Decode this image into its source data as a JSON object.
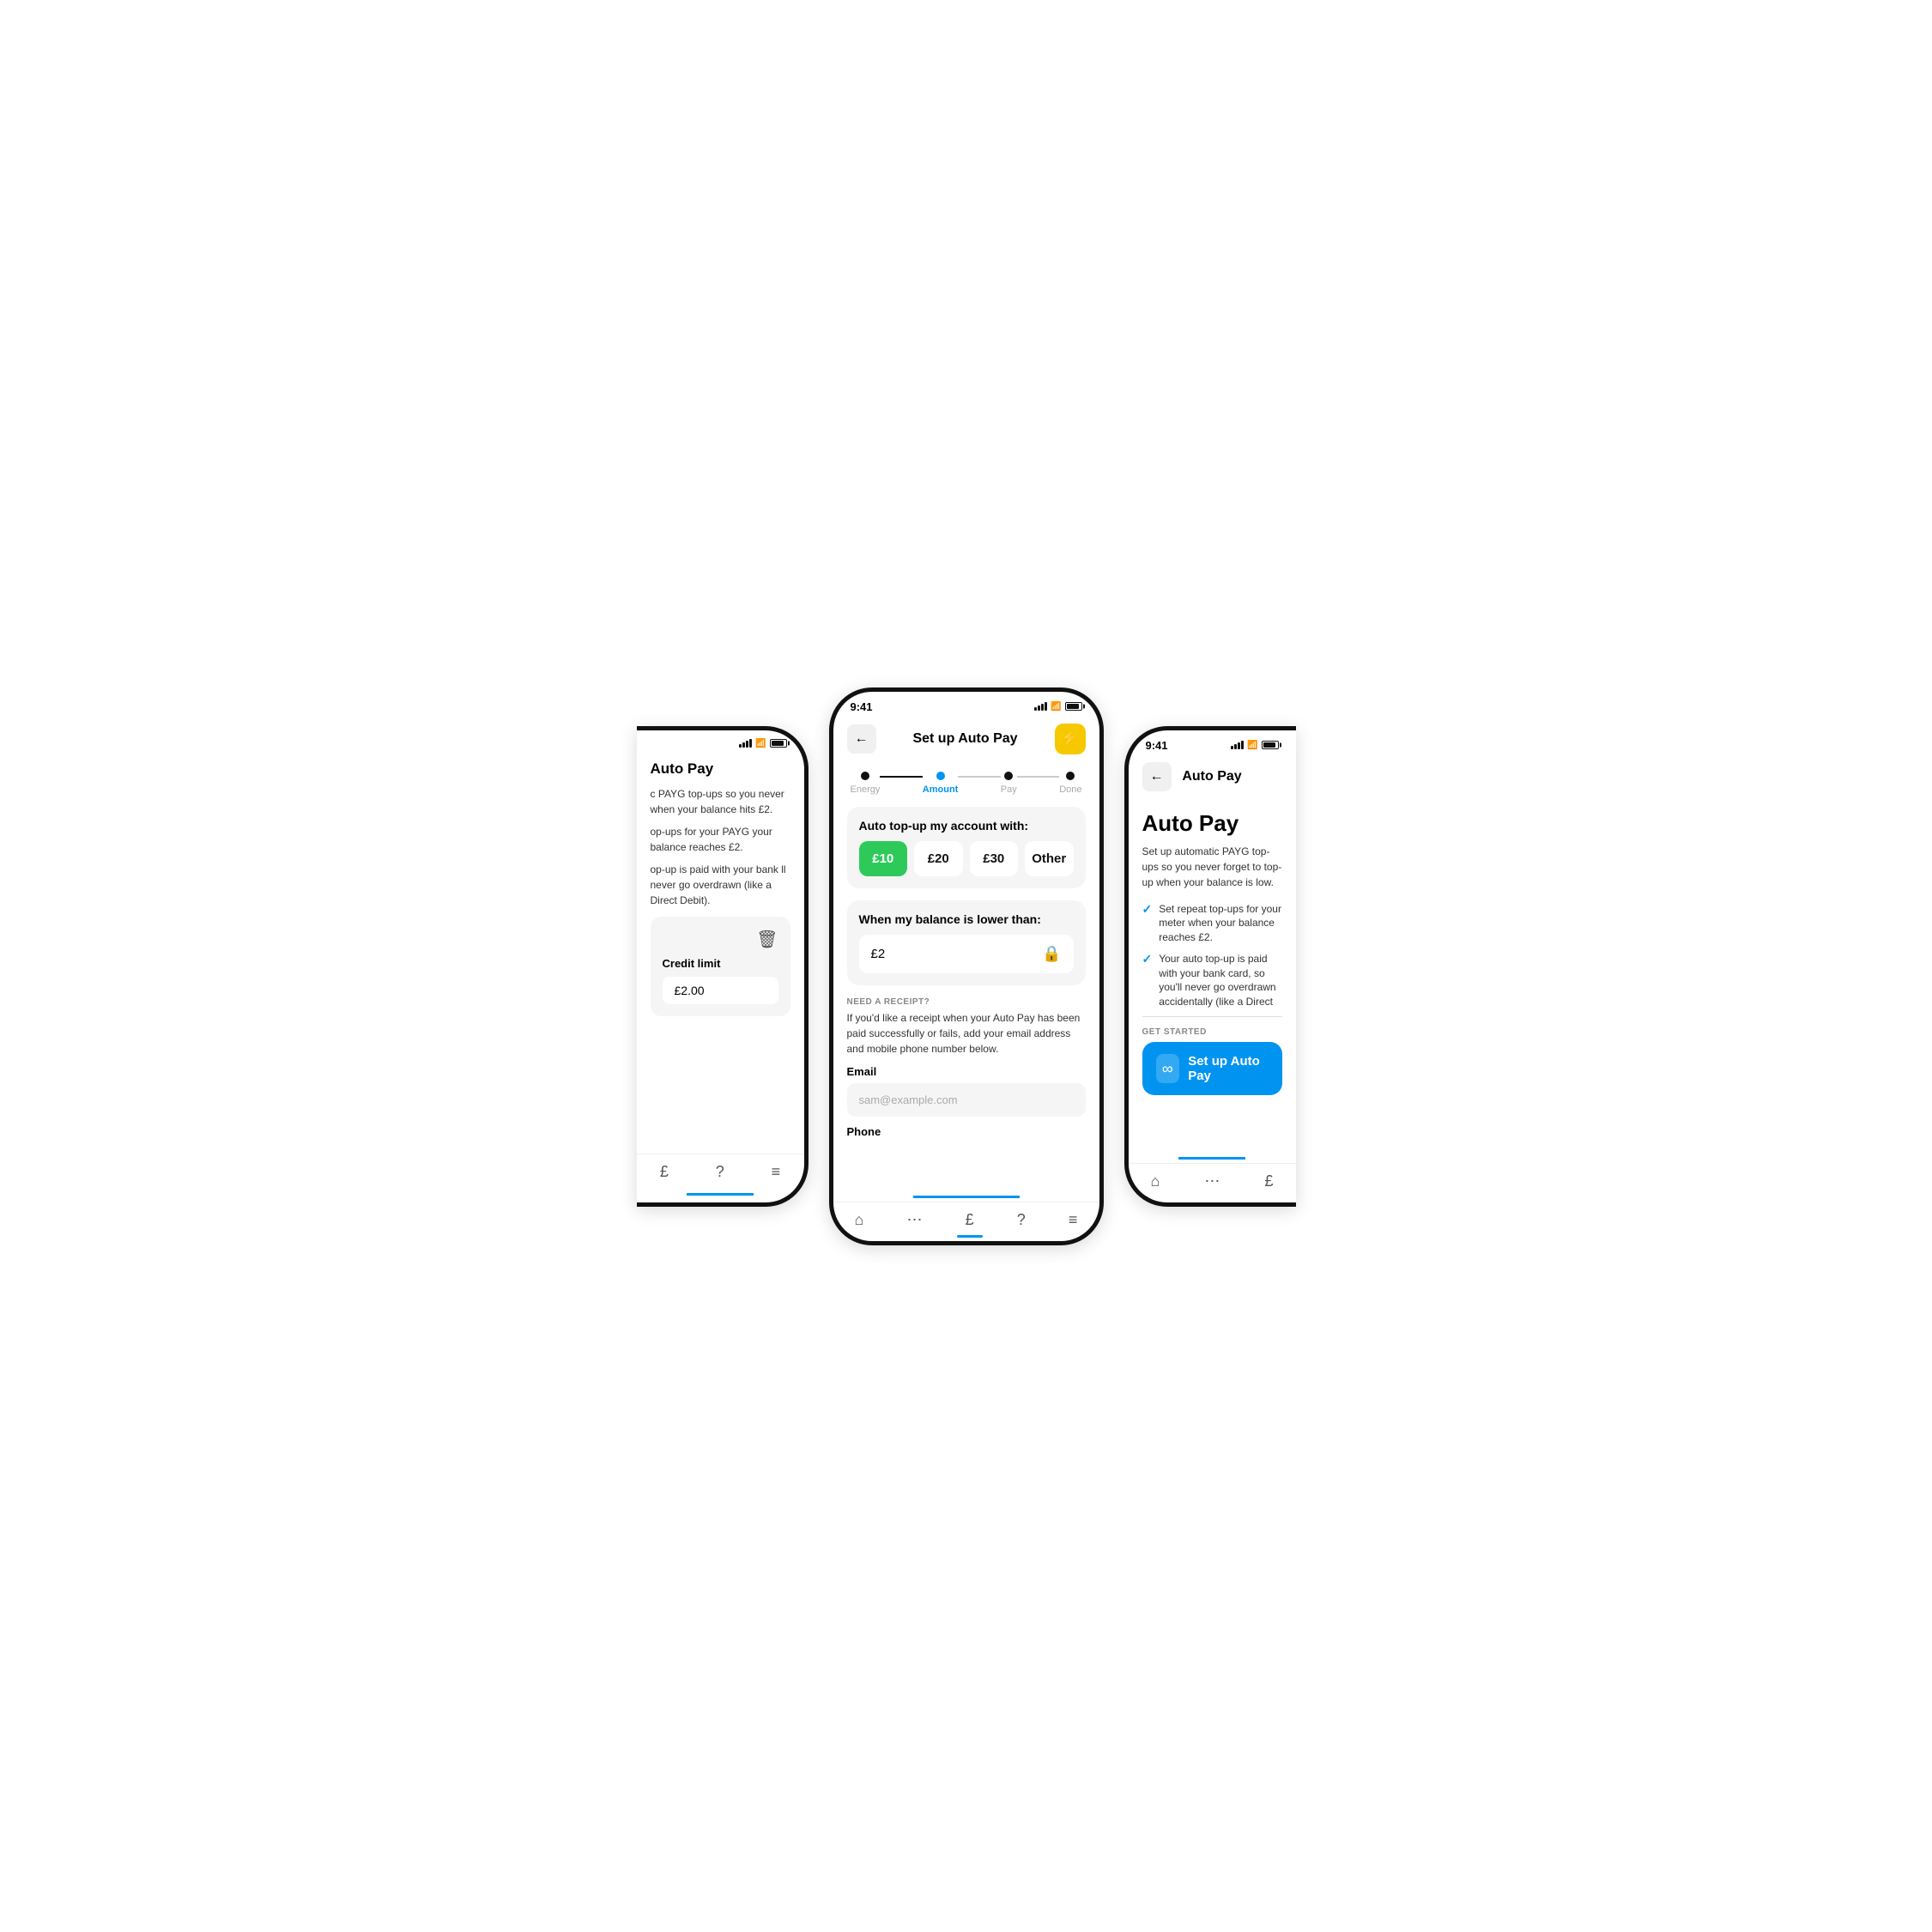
{
  "scene": {
    "background": "#ffffff"
  },
  "left_phone": {
    "title": "Auto Pay",
    "desc1": "c PAYG top-ups so you never when your balance hits £2.",
    "desc2": "op-ups for your PAYG your balance reaches £2.",
    "desc3": "op-up is paid with your bank ll never go overdrawn (like a Direct Debit).",
    "credit_limit_label": "Credit limit",
    "credit_limit_value": "£2.00",
    "bottom_tabs": [
      "£",
      "?",
      "≡"
    ]
  },
  "center_phone": {
    "status_time": "9:41",
    "nav_title": "Set up Auto Pay",
    "nav_back": "←",
    "nav_action_icon": "⚡",
    "stepper": {
      "steps": [
        "Energy",
        "Amount",
        "Pay",
        "Done"
      ],
      "active_index": 1
    },
    "auto_topup_label": "Auto top-up my account with:",
    "amount_options": [
      {
        "label": "£10",
        "selected": true
      },
      {
        "label": "£20",
        "selected": false
      },
      {
        "label": "£30",
        "selected": false
      },
      {
        "label": "Other",
        "selected": false
      }
    ],
    "balance_label": "When my balance is lower than:",
    "balance_value": "£2",
    "receipt_heading": "NEED A RECEIPT?",
    "receipt_desc": "If you'd like a receipt when your Auto Pay has been paid successfully or fails, add your email address and mobile phone number below.",
    "email_label": "Email",
    "email_placeholder": "sam@example.com",
    "phone_label": "Phone",
    "bottom_tabs": [
      "🏠",
      "⋯",
      "£",
      "?",
      "≡"
    ]
  },
  "right_phone": {
    "status_time": "9:41",
    "nav_title": "Auto Pay",
    "nav_back": "←",
    "big_title": "Auto Pay",
    "desc": "Set up automatic PAYG top-ups so you never forget to top-up when your balance is low.",
    "check_items": [
      "Set repeat top-ups for your meter when your balance reaches £2.",
      "Your auto top-up is paid with your bank card, so you'll never go overdrawn accidentally (like a Direct Debit)."
    ],
    "get_started_label": "GET STARTED",
    "setup_btn_label": "Set up Auto Pay",
    "bottom_tabs": [
      "🏠",
      "⋯",
      "£"
    ]
  },
  "colors": {
    "primary_blue": "#0094f0",
    "green": "#2dca5a",
    "yellow": "#f5c800",
    "light_bg": "#f5f5f5",
    "border": "#e0e0e0"
  }
}
